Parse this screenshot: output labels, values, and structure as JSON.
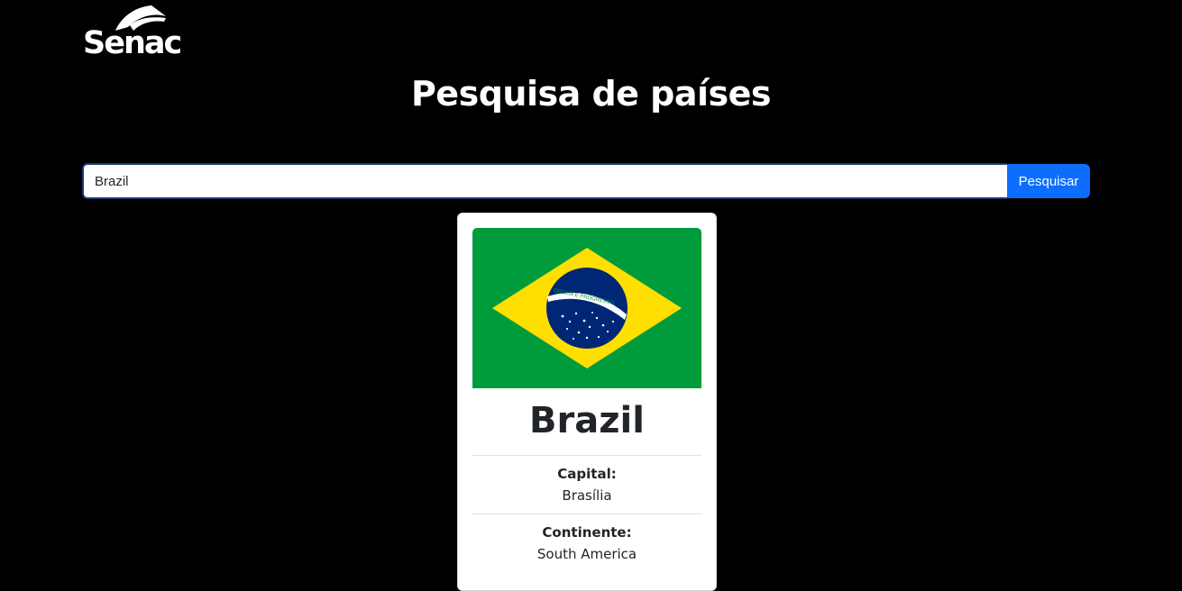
{
  "header": {
    "logo_text": "Senac",
    "title": "Pesquisa de países"
  },
  "search": {
    "value": "Brazil",
    "placeholder": "",
    "button_label": "Pesquisar"
  },
  "result": {
    "country_name": "Brazil",
    "flag_motto": "ORDEM E PROGRESSO",
    "fields": [
      {
        "label": "Capital:",
        "value": "Brasília"
      },
      {
        "label": "Continente:",
        "value": "South America"
      }
    ]
  },
  "colors": {
    "background": "#000000",
    "accent": "#0d6efd",
    "flag_green": "#009c3b",
    "flag_yellow": "#ffdf00",
    "flag_blue": "#002776"
  }
}
